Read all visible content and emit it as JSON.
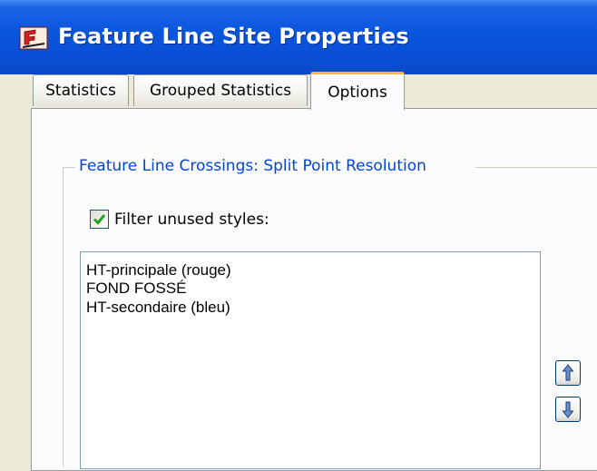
{
  "window": {
    "title": "Feature Line Site Properties",
    "icon": "autocad-civil-icon"
  },
  "tabs": [
    {
      "label": "Statistics",
      "active": false
    },
    {
      "label": "Grouped Statistics",
      "active": false
    },
    {
      "label": "Options",
      "active": true
    }
  ],
  "options": {
    "group_label": "Feature Line Crossings: Split Point Resolution",
    "filter_checkbox": {
      "label": "Filter unused styles:",
      "checked": true
    },
    "styles_list": [
      "HT-principale (rouge)",
      "FOND FOSSÉ",
      "HT-secondaire (bleu)"
    ],
    "move_up_icon": "arrow-up-icon",
    "move_down_icon": "arrow-down-icon"
  },
  "colors": {
    "titlebar": "#0855dd",
    "group_label": "#0046d5",
    "active_tab_accent": "#f7b54a",
    "checkmark": "#21a121"
  }
}
